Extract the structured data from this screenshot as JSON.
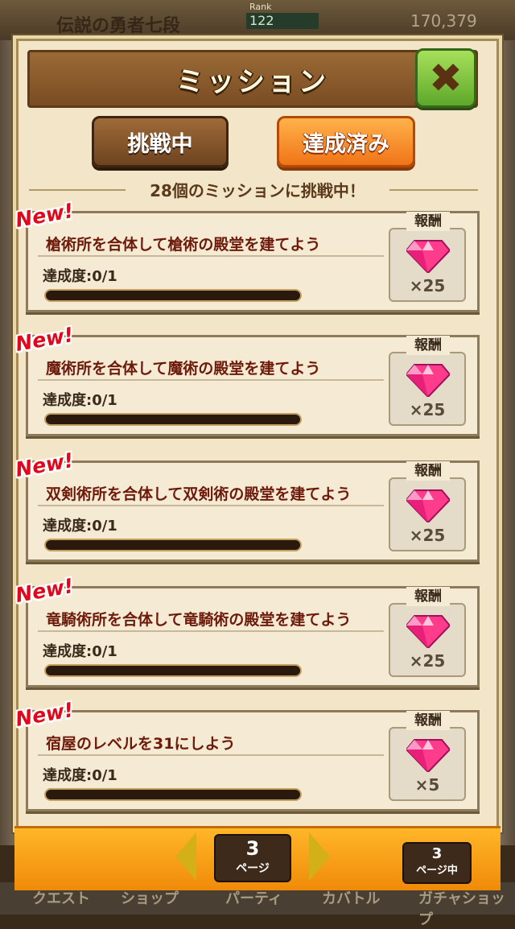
{
  "background": {
    "player_name": "伝説の勇者七段",
    "rank_label": "Rank",
    "rank_value": "122",
    "exp_value": "170,379",
    "bottom_tabs": [
      "クエスト",
      "ショップ",
      "パーティ",
      "カバトル",
      "ガチャショップ"
    ]
  },
  "dialog": {
    "title": "ミッション",
    "close_icon": "close-x-icon",
    "tabs": {
      "in_progress": "挑戦中",
      "completed": "達成済み"
    },
    "mission_count_text": "28個のミッションに挑戦中！"
  },
  "missions": [
    {
      "badge": "New!",
      "name": "槍術所を合体して槍術の殿堂を建てよう",
      "progress_text": "達成度:0/1",
      "progress": 0,
      "reward_label": "報酬",
      "reward_icon": "pink-gem-icon",
      "reward_amount": "×25"
    },
    {
      "badge": "New!",
      "name": "魔術所を合体して魔術の殿堂を建てよう",
      "progress_text": "達成度:0/1",
      "progress": 0,
      "reward_label": "報酬",
      "reward_icon": "pink-gem-icon",
      "reward_amount": "×25"
    },
    {
      "badge": "New!",
      "name": "双剣術所を合体して双剣術の殿堂を建てよう",
      "progress_text": "達成度:0/1",
      "progress": 0,
      "reward_label": "報酬",
      "reward_icon": "pink-gem-icon",
      "reward_amount": "×25"
    },
    {
      "badge": "New!",
      "name": "竜騎術所を合体して竜騎術の殿堂を建てよう",
      "progress_text": "達成度:0/1",
      "progress": 0,
      "reward_label": "報酬",
      "reward_icon": "pink-gem-icon",
      "reward_amount": "×25"
    },
    {
      "badge": "New!",
      "name": "宿屋のレベルを31にしよう",
      "progress_text": "達成度:0/1",
      "progress": 0,
      "reward_label": "報酬",
      "reward_icon": "pink-gem-icon",
      "reward_amount": "×5"
    }
  ],
  "pager": {
    "current_page": "3",
    "current_unit": "ページ",
    "total_pages": "3",
    "total_unit": "ページ中"
  },
  "colors": {
    "accent_orange": "#f07418",
    "title_brown": "#7a4c22",
    "gem_pink": "#ff3c8c",
    "new_red": "#e2081c"
  }
}
